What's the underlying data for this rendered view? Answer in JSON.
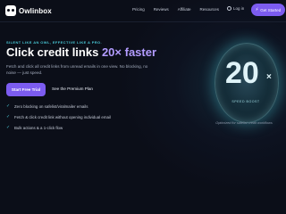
{
  "brand": {
    "name": "Owlinbox",
    "logo_icon": "owl-icon"
  },
  "nav": {
    "links": [
      "Pricing",
      "Reviews",
      "Affiliate",
      "Resources"
    ],
    "login_label": "Log in",
    "cta_label": "Get Started"
  },
  "hero": {
    "eyebrow": "SILENT LIKE AN OWL, EFFECTIVE LIKE A PRO.",
    "title_main": "Click credit links",
    "title_accent": "20× faster",
    "subtitle": "Fetch and click all credit links from unread emails in one view. No blocking, no noise — just speed.",
    "primary_button": "Start Free Trial",
    "secondary_link": "See the Premium Plan",
    "features": [
      "Zero blocking on safelist/viralmailer emails",
      "Fetch & click credit link without opening individual email",
      "Bulk actions & a 1-click flow"
    ]
  },
  "badge": {
    "value": "20",
    "suffix": "×",
    "label": "SPEED BOOST",
    "caption": "Optimized for safelist credit workflows"
  },
  "colors": {
    "accent": "#7c5cf0",
    "accent_light": "#b39cff",
    "teal": "#48c6d4",
    "background": "#0b0e18"
  }
}
